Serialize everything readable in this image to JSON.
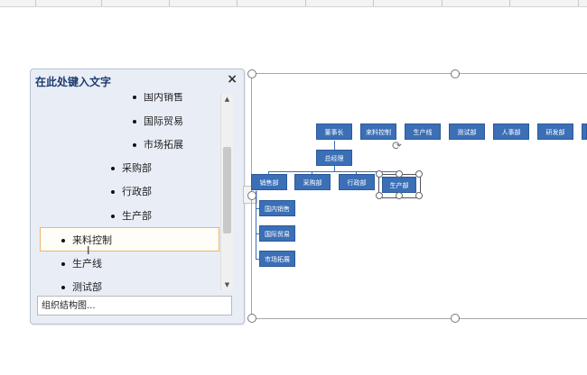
{
  "pane": {
    "title": "在此处键入文字",
    "close": "×",
    "items": [
      {
        "label": "国内销售",
        "level": 3
      },
      {
        "label": "国际贸易",
        "level": 3
      },
      {
        "label": "市场拓展",
        "level": 3
      },
      {
        "label": "采购部",
        "level": 2
      },
      {
        "label": "行政部",
        "level": 2
      },
      {
        "label": "生产部",
        "level": 2
      },
      {
        "label": "来料控制",
        "level": 1
      },
      {
        "label": "生产线",
        "level": 1
      },
      {
        "label": "测试部",
        "level": 1
      }
    ],
    "footer": "组织结构图...",
    "toggle": "›"
  },
  "diagram": {
    "top_row": [
      "董事长",
      "来料控制",
      "生产线",
      "测试部",
      "人事部",
      "研发部"
    ],
    "manager": "总经理",
    "departments": [
      "销售部",
      "采购部",
      "行政部",
      "生产部"
    ],
    "sub_items": [
      "国内销售",
      "国际贸易",
      "市场拓展"
    ],
    "box_color": "#3b6fb6"
  }
}
